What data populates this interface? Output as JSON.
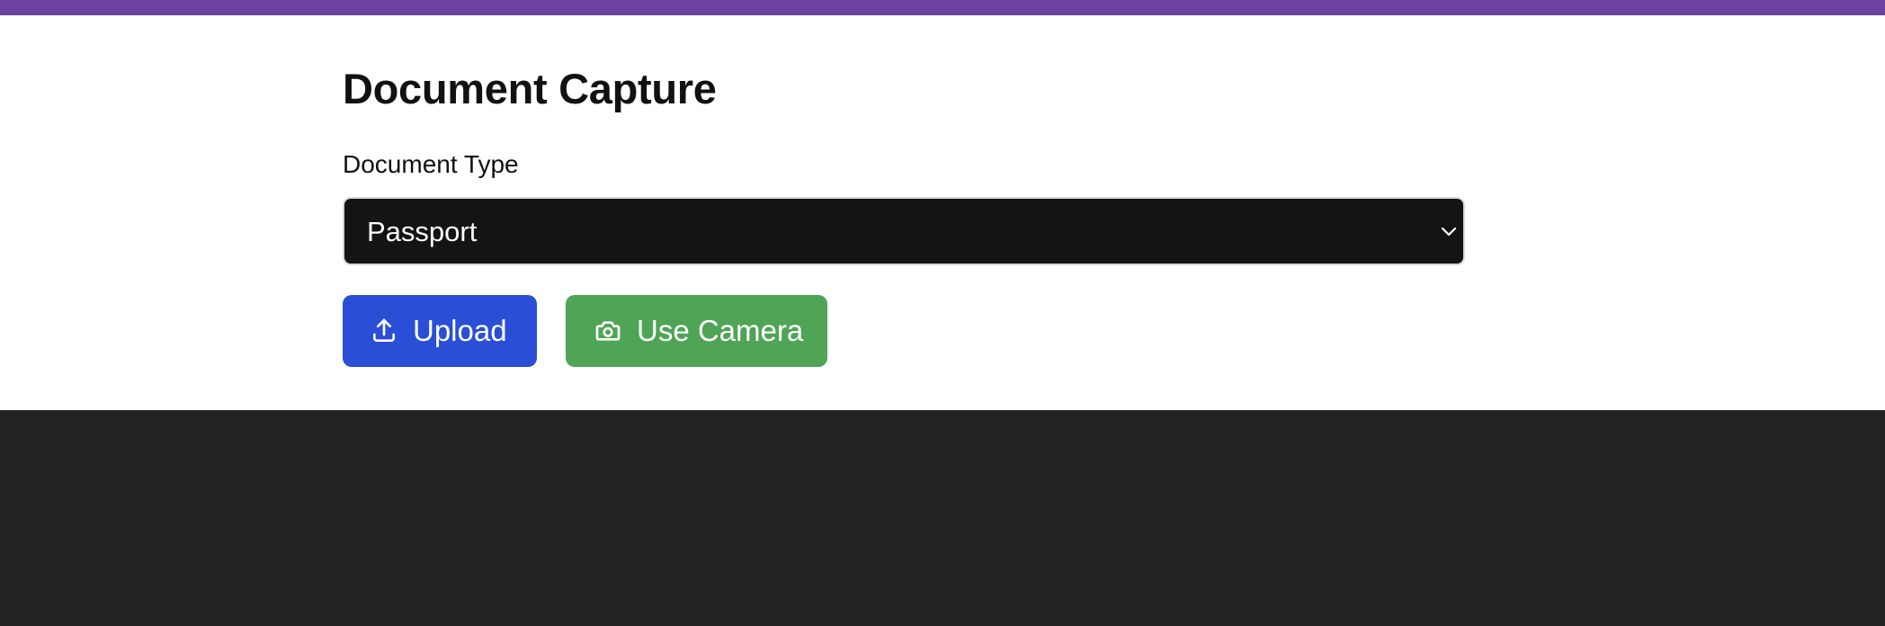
{
  "header": {
    "accent_color": "#6b42a0"
  },
  "main": {
    "title": "Document Capture",
    "document_type": {
      "label": "Document Type",
      "selected": "Passport",
      "chevron_icon": "chevron-down-icon"
    },
    "actions": {
      "upload": {
        "label": "Upload",
        "icon": "upload-icon",
        "color": "#2a4fd6"
      },
      "camera": {
        "label": "Use Camera",
        "icon": "camera-icon",
        "color": "#4fa456"
      }
    }
  },
  "footer": {
    "background": "#232323"
  }
}
